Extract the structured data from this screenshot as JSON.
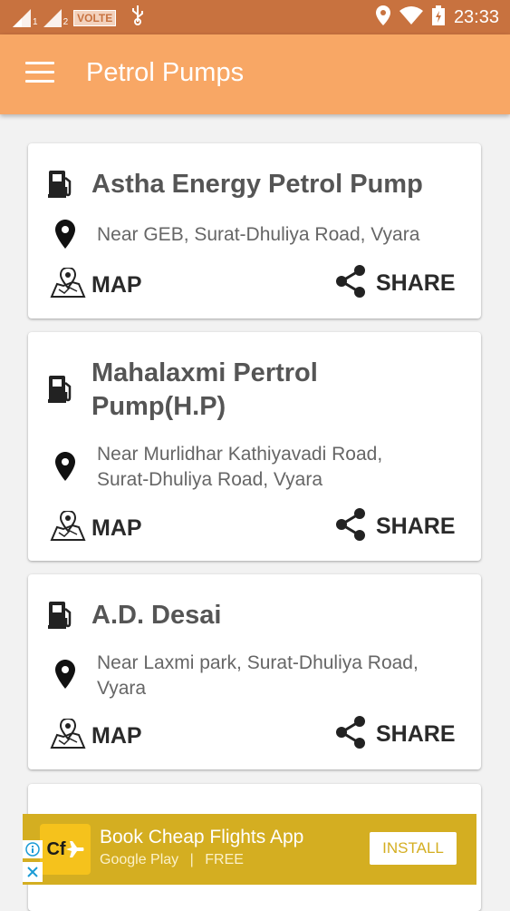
{
  "status_bar": {
    "network_badge": "VOLTE",
    "sim1": "1",
    "sim2": "2",
    "time": "23:33",
    "icons": [
      "signal-icon",
      "signal-icon",
      "usb-icon",
      "location-icon",
      "wifi-icon",
      "battery-icon"
    ]
  },
  "app_bar": {
    "title": "Petrol Pumps",
    "menu_icon": "hamburger-menu-icon"
  },
  "pumps": [
    {
      "name": "Astha Energy Petrol Pump",
      "address": "Near GEB, Surat-Dhuliya Road, Vyara",
      "map_label": "MAP",
      "share_label": "SHARE"
    },
    {
      "name_line1": "Mahalaxmi  Pertrol",
      "name_line2": "Pump(H.P)",
      "address_line1": "Near Murlidhar Kathiyavadi Road,",
      "address_line2": "Surat-Dhuliya Road, Vyara",
      "map_label": "MAP",
      "share_label": "SHARE"
    },
    {
      "name": "A.D. Desai",
      "address_line1": "Near Laxmi park, Surat-Dhuliya Road,",
      "address_line2": "Vyara",
      "map_label": "MAP",
      "share_label": "SHARE"
    }
  ],
  "ad": {
    "logo_text": "Cf",
    "title": "Book Cheap Flights App",
    "store": "Google Play",
    "separator": "|",
    "price": "FREE",
    "install_label": "INSTALL",
    "info_icon": "info-icon",
    "close_icon": "close-icon"
  },
  "colors": {
    "status_bar": "#c8723f",
    "app_bar": "#f8a765",
    "ad_background": "#d4ae21"
  }
}
